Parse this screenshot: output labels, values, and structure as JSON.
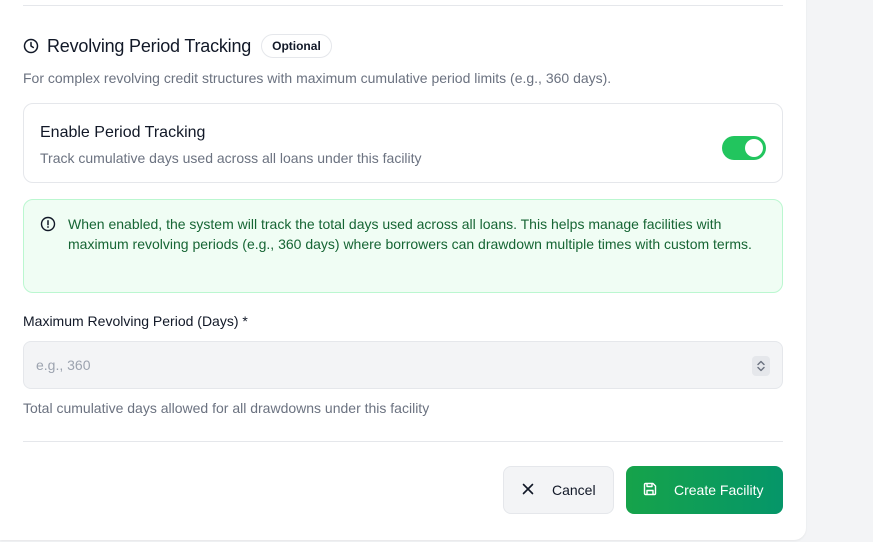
{
  "section": {
    "title": "Revolving Period Tracking",
    "badge": "Optional",
    "description": "For complex revolving credit structures with maximum cumulative period limits (e.g., 360 days)."
  },
  "toggle": {
    "title": "Enable Period Tracking",
    "subtitle": "Track cumulative days used across all loans under this facility",
    "enabled": true
  },
  "info": {
    "text": "When enabled, the system will track the total days used across all loans. This helps manage facilities with maximum revolving periods (e.g., 360 days) where borrowers can drawdown multiple times with custom terms."
  },
  "field": {
    "label": "Maximum Revolving Period (Days) *",
    "placeholder": "e.g., 360",
    "value": "",
    "hint": "Total cumulative days allowed for all drawdowns under this facility"
  },
  "actions": {
    "cancel_label": "Cancel",
    "create_label": "Create Facility"
  },
  "icons": {
    "section": "clock-icon",
    "info": "info-circle-icon",
    "cancel": "close-icon",
    "create": "save-icon",
    "stepper": "chevron-up-down-icon"
  },
  "colors": {
    "accent": "#22c55e",
    "primary_button": "#16a34a",
    "info_background": "#f0fdf4",
    "info_text": "#166534"
  }
}
